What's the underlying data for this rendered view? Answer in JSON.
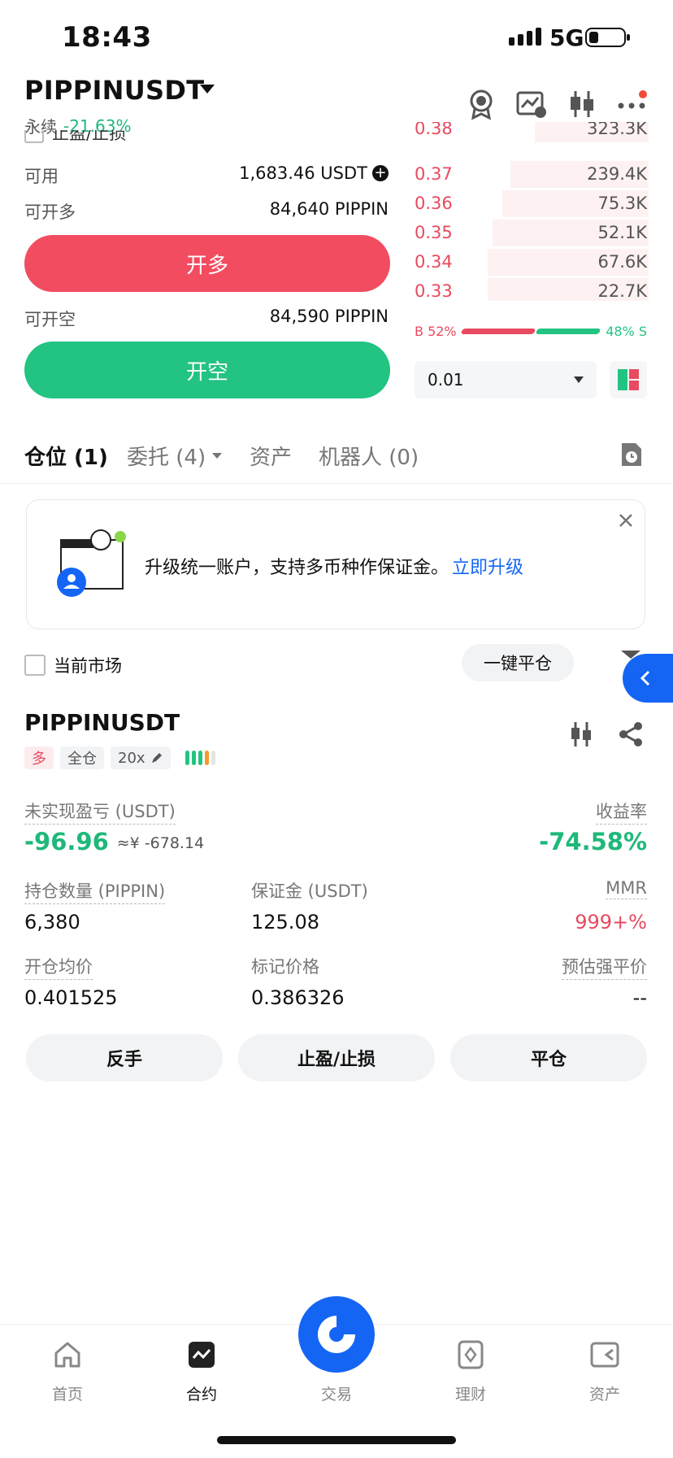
{
  "status": {
    "time": "18:43",
    "network": "5G"
  },
  "header": {
    "symbol": "PIPPINUSDT",
    "type": "永续",
    "change": "-21.63%"
  },
  "form": {
    "tpsl_label": "止盈/止损",
    "available_label": "可用",
    "available_value": "1,683.46 USDT",
    "open_long_label": "可开多",
    "open_long_value": "84,640 PIPPIN",
    "buy_button": "开多",
    "open_short_label": "可开空",
    "open_short_value": "84,590 PIPPIN",
    "sell_button": "开空"
  },
  "orderbook": {
    "asks": [
      {
        "price": "0.38",
        "qty": "323.3K",
        "depth": 0.44
      },
      {
        "price": "0.37",
        "qty": "239.4K",
        "depth": 0.53
      },
      {
        "price": "0.36",
        "qty": "75.3K",
        "depth": 0.56
      },
      {
        "price": "0.35",
        "qty": "52.1K",
        "depth": 0.6
      },
      {
        "price": "0.34",
        "qty": "67.6K",
        "depth": 0.62
      },
      {
        "price": "0.33",
        "qty": "22.7K",
        "depth": 0.62
      }
    ],
    "buy_ratio": "B 52%",
    "sell_ratio": "48% S",
    "buy_pct": 52,
    "precision": "0.01"
  },
  "tabs": [
    {
      "label": "仓位 (1)"
    },
    {
      "label": "委托 (4)"
    },
    {
      "label": "资产"
    },
    {
      "label": "机器人 (0)"
    }
  ],
  "banner": {
    "text": "升级统一账户，支持多币种作保证金。",
    "link": "立即升级"
  },
  "filter": {
    "current_market": "当前市场",
    "close_all": "一键平仓"
  },
  "position": {
    "symbol": "PIPPINUSDT",
    "side": "多",
    "margin_mode": "全仓",
    "leverage": "20x",
    "upnl_label": "未实现盈亏 (USDT)",
    "upnl_value": "-96.96",
    "upnl_cny": "≈¥ -678.14",
    "roe_label": "收益率",
    "roe_value": "-74.58%",
    "size_label": "持仓数量 (PIPPIN)",
    "size_value": "6,380",
    "margin_label": "保证金 (USDT)",
    "margin_value": "125.08",
    "mmr_label": "MMR",
    "mmr_value": "999+%",
    "entry_label": "开仓均价",
    "entry_value": "0.401525",
    "mark_label": "标记价格",
    "mark_value": "0.386326",
    "liq_label": "预估强平价",
    "liq_value": "--",
    "reverse_button": "反手",
    "tpsl_button": "止盈/止损",
    "close_button": "平仓"
  },
  "nav": [
    {
      "label": "首页"
    },
    {
      "label": "合约"
    },
    {
      "label": "交易"
    },
    {
      "label": "理财"
    },
    {
      "label": "资产"
    }
  ],
  "colors": {
    "up": "#1fb87a",
    "down": "#e84a5f",
    "accent": "#1565f5",
    "buy_btn": "#f24c60",
    "sell_btn": "#23c382"
  }
}
